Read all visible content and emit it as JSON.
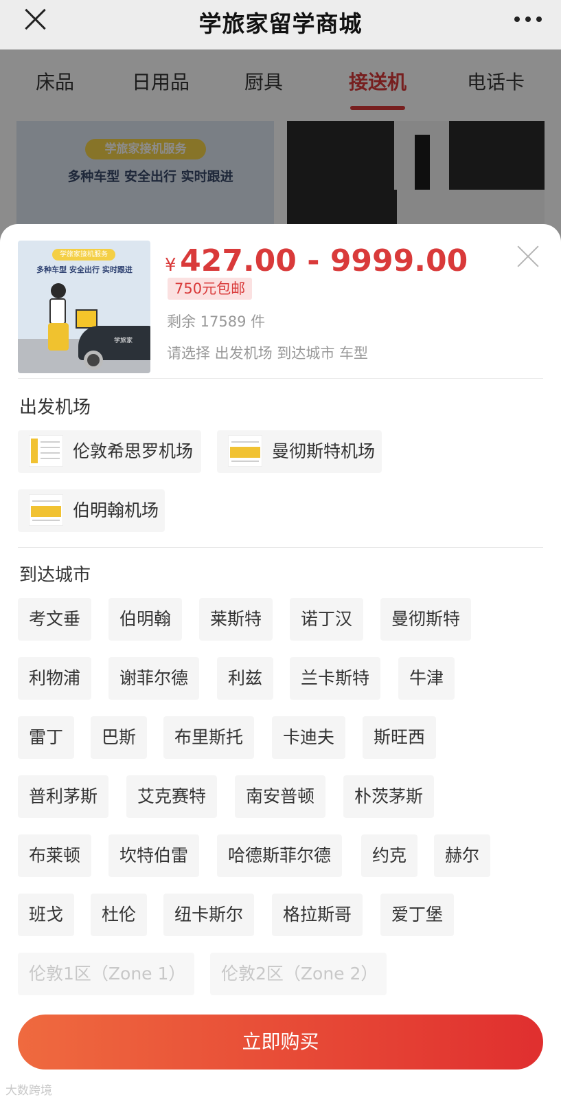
{
  "navbar": {
    "title": "学旅家留学商城"
  },
  "tabs": [
    {
      "label": "床品"
    },
    {
      "label": "日用品"
    },
    {
      "label": "厨具"
    },
    {
      "label": "接送机",
      "active": true
    },
    {
      "label": "电话卡"
    }
  ],
  "banner": {
    "pill": "学旅家接机服务",
    "slogan": "多种车型 安全出行 实时跟进"
  },
  "product": {
    "image_pill": "学旅家接机服务",
    "image_slogan": "多种车型 安全出行 实时跟进",
    "image_brand": "学旅家",
    "currency": "¥",
    "price_range": "427.00 - 9999.00",
    "shipping_badge": "750元包邮",
    "stock": "剩余 17589 件",
    "select_hint": "请选择 出发机场 到达城市 车型"
  },
  "departure": {
    "title": "出发机场",
    "options": [
      "伦敦希思罗机场",
      "曼彻斯特机场",
      "伯明翰机场"
    ]
  },
  "arrival": {
    "title": "到达城市",
    "options": [
      "考文垂",
      "伯明翰",
      "莱斯特",
      "诺丁汉",
      "曼彻斯特",
      "利物浦",
      "谢菲尔德",
      "利兹",
      "兰卡斯特",
      "牛津",
      "雷丁",
      "巴斯",
      "布里斯托",
      "卡迪夫",
      "斯旺西",
      "普利茅斯",
      "艾克赛特",
      "南安普顿",
      "朴茨茅斯",
      "布莱顿",
      "坎特伯雷",
      "哈德斯菲尔德",
      "约克",
      "赫尔",
      "班戈",
      "杜伦",
      "纽卡斯尔",
      "格拉斯哥",
      "爱丁堡"
    ],
    "disabled_options": [
      "伦敦1区（Zone 1）",
      "伦敦2区（Zone 2）"
    ]
  },
  "buy_button": "立即购买",
  "watermark": "大数跨境",
  "colors": {
    "accent": "#d93a3a",
    "button_start": "#ef6a3f",
    "button_end": "#e02f2f"
  }
}
